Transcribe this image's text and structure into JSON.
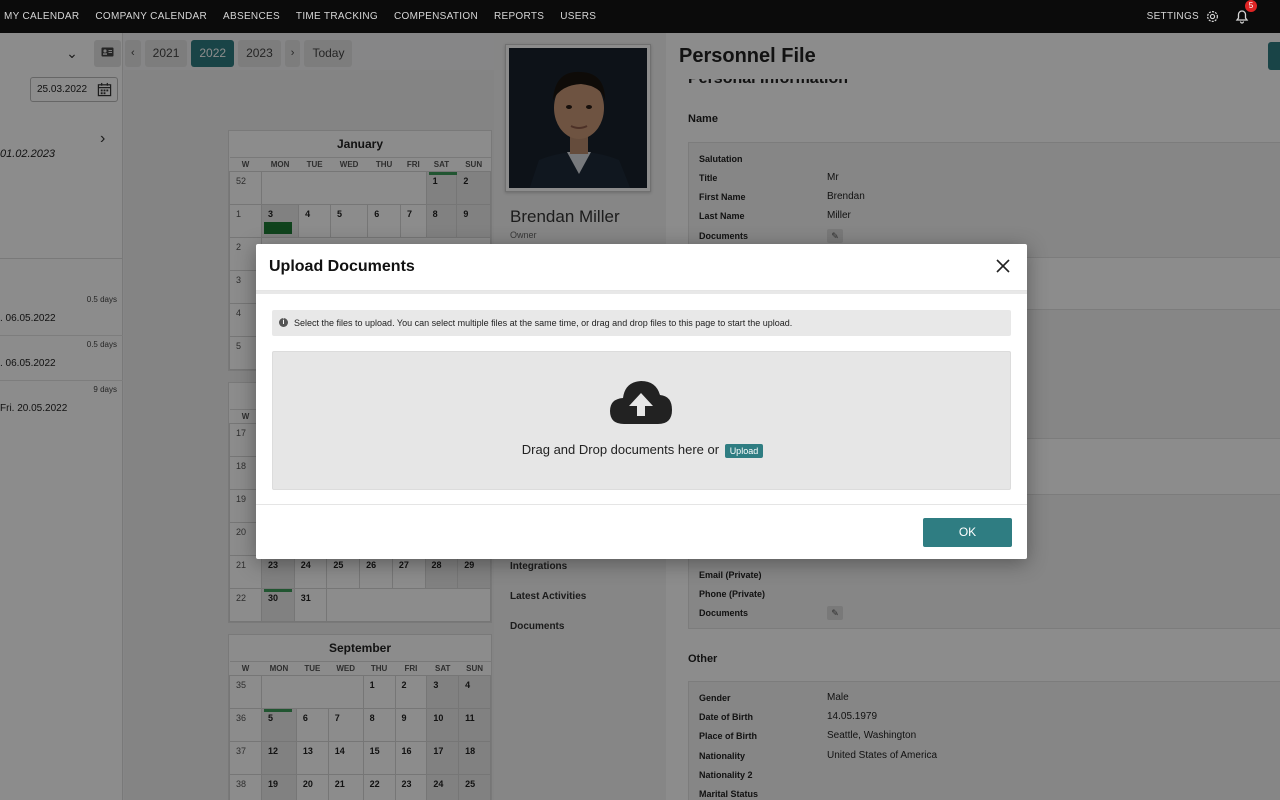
{
  "nav": {
    "items": [
      "MY CALENDAR",
      "COMPANY CALENDAR",
      "ABSENCES",
      "TIME TRACKING",
      "COMPENSATION",
      "REPORTS",
      "USERS"
    ],
    "settings_label": "SETTINGS",
    "notification_count": "5"
  },
  "left": {
    "date_input": "25.03.2022",
    "period_end": "01.02.2023",
    "absences": [
      {
        "days": "0.5 days",
        "date": ". 06.05.2022"
      },
      {
        "days": "0.5 days",
        "date": ". 06.05.2022"
      },
      {
        "days": "9 days",
        "date": "Fri. 20.05.2022"
      }
    ]
  },
  "calendar": {
    "years": [
      "2021",
      "2022",
      "2023"
    ],
    "active_year": "2022",
    "today_label": "Today",
    "weekday_headers": [
      "W",
      "MON",
      "TUE",
      "WED",
      "THU",
      "FRI",
      "SAT",
      "SUN"
    ],
    "january": {
      "title": "January",
      "rows": [
        [
          "52",
          "",
          "",
          "",
          "",
          "",
          "1",
          "2"
        ],
        [
          "1",
          "3",
          "4",
          "5",
          "6",
          "7",
          "8",
          "9"
        ],
        [
          "2",
          "",
          "",
          "",
          "",
          "",
          "",
          ""
        ],
        [
          "3",
          "",
          "",
          "",
          "",
          "",
          "",
          ""
        ],
        [
          "4",
          "",
          "",
          "",
          "",
          "",
          "",
          ""
        ],
        [
          "5",
          "",
          "",
          "",
          "",
          "",
          "",
          ""
        ]
      ]
    },
    "may": {
      "week_header": "W",
      "rows": [
        [
          "17",
          "",
          "",
          "",
          "",
          "",
          "",
          ""
        ],
        [
          "18",
          "",
          "",
          "",
          "",
          "",
          "",
          ""
        ],
        [
          "19",
          "",
          "",
          "",
          "",
          "",
          "",
          ""
        ],
        [
          "20",
          "",
          "",
          "",
          "",
          "",
          "",
          ""
        ],
        [
          "21",
          "23",
          "24",
          "25",
          "26",
          "27",
          "28",
          "29"
        ],
        [
          "22",
          "30",
          "31",
          "",
          "",
          "",
          "",
          ""
        ]
      ]
    },
    "september": {
      "title": "September",
      "rows": [
        [
          "35",
          "",
          "",
          "",
          "1",
          "2",
          "3",
          "4"
        ],
        [
          "36",
          "5",
          "6",
          "7",
          "8",
          "9",
          "10",
          "11"
        ],
        [
          "37",
          "12",
          "13",
          "14",
          "15",
          "16",
          "17",
          "18"
        ],
        [
          "38",
          "19",
          "20",
          "21",
          "22",
          "23",
          "24",
          "25"
        ]
      ]
    }
  },
  "profile": {
    "name": "Brendan Miller",
    "role": "Owner",
    "menu": [
      "Integrations",
      "Latest Activities",
      "Documents"
    ]
  },
  "personnel_file": {
    "title": "Personnel File",
    "section_personal": "Personal Information",
    "section_name": "Name",
    "name_fields": [
      {
        "label": "Salutation",
        "value": ""
      },
      {
        "label": "Title",
        "value": "Mr"
      },
      {
        "label": "First Name",
        "value": "Brendan"
      },
      {
        "label": "Last Name",
        "value": "Miller"
      },
      {
        "label": "Documents",
        "value": ""
      }
    ],
    "contact_fields": [
      {
        "label": "Email (Private)",
        "value": ""
      },
      {
        "label": "Phone (Private)",
        "value": ""
      },
      {
        "label": "Documents",
        "value": ""
      }
    ],
    "section_other": "Other",
    "other_fields": [
      {
        "label": "Gender",
        "value": "Male"
      },
      {
        "label": "Date of Birth",
        "value": "14.05.1979"
      },
      {
        "label": "Place of Birth",
        "value": "Seattle, Washington"
      },
      {
        "label": "Nationality",
        "value": "United States of America"
      },
      {
        "label": "Nationality 2",
        "value": ""
      },
      {
        "label": "Marital Status",
        "value": ""
      }
    ]
  },
  "modal": {
    "title": "Upload Documents",
    "info": "Select the files to upload. You can select multiple files at the same time, or drag and drop files to this page to start the upload.",
    "drop_text": "Drag and Drop documents here or",
    "upload_label": "Upload",
    "ok_label": "OK"
  },
  "colors": {
    "accent": "#2f7d82",
    "nav_bg": "#0b0b0b",
    "absence_green": "#1e7a35",
    "badge_red": "#e02424"
  }
}
